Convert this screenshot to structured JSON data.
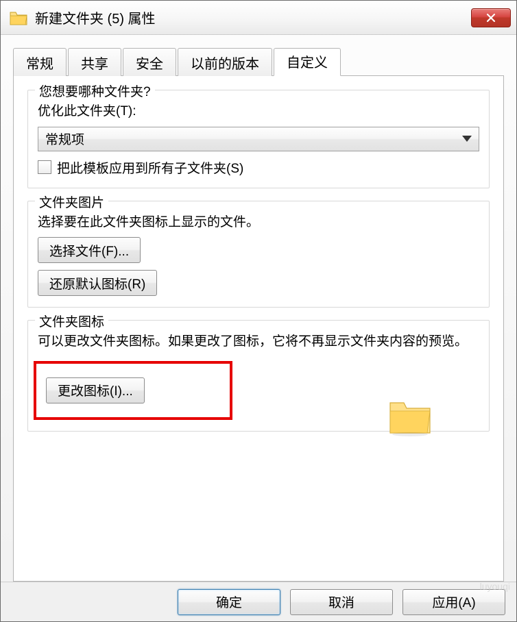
{
  "window": {
    "title": "新建文件夹 (5) 属性"
  },
  "tabs": [
    {
      "label": "常规"
    },
    {
      "label": "共享"
    },
    {
      "label": "安全"
    },
    {
      "label": "以前的版本"
    },
    {
      "label": "自定义"
    }
  ],
  "group1": {
    "title": "您想要哪种文件夹?",
    "optimize_label": "优化此文件夹(T):",
    "select_value": "常规项",
    "checkbox_label": "把此模板应用到所有子文件夹(S)"
  },
  "group2": {
    "title": "文件夹图片",
    "desc": "选择要在此文件夹图标上显示的文件。",
    "choose_btn": "选择文件(F)...",
    "restore_btn": "还原默认图标(R)"
  },
  "group3": {
    "title": "文件夹图标",
    "desc": "可以更改文件夹图标。如果更改了图标，它将不再显示文件夹内容的预览。",
    "change_btn": "更改图标(I)..."
  },
  "buttons": {
    "ok": "确定",
    "cancel": "取消",
    "apply": "应用(A)"
  },
  "watermark": "luyouqi"
}
